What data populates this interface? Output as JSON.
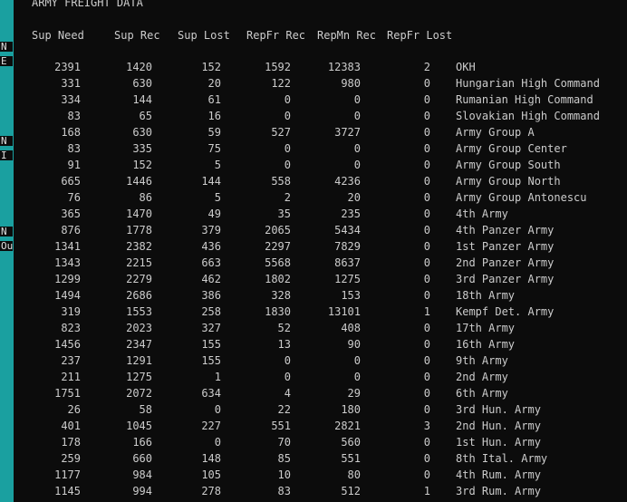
{
  "strip": {
    "fragments": [
      "N",
      "E",
      "N",
      "I",
      "N",
      "Ou"
    ]
  },
  "terminal": {
    "title": "ARMY FREIGHT DATA",
    "columns": {
      "sup_need": "Sup Need",
      "sup_rec": "Sup Rec",
      "sup_lost": "Sup Lost",
      "repfr_rec": "RepFr Rec",
      "repmn_rec": "RepMn Rec",
      "repfr_lost": "RepFr Lost"
    },
    "rows": [
      [
        "2391",
        "1420",
        "152",
        "1592",
        "12383",
        "2",
        "OKH"
      ],
      [
        "331",
        "630",
        "20",
        "122",
        "980",
        "0",
        "Hungarian High Command"
      ],
      [
        "334",
        "144",
        "61",
        "0",
        "0",
        "0",
        "Rumanian High Command"
      ],
      [
        "83",
        "65",
        "16",
        "0",
        "0",
        "0",
        "Slovakian High Command"
      ],
      [
        "168",
        "630",
        "59",
        "527",
        "3727",
        "0",
        "Army Group A"
      ],
      [
        "83",
        "335",
        "75",
        "0",
        "0",
        "0",
        "Army Group Center"
      ],
      [
        "91",
        "152",
        "5",
        "0",
        "0",
        "0",
        "Army Group South"
      ],
      [
        "665",
        "1446",
        "144",
        "558",
        "4236",
        "0",
        "Army Group North"
      ],
      [
        "76",
        "86",
        "5",
        "2",
        "20",
        "0",
        "Army Group Antonescu"
      ],
      [
        "365",
        "1470",
        "49",
        "35",
        "235",
        "0",
        "4th Army"
      ],
      [
        "876",
        "1778",
        "379",
        "2065",
        "5434",
        "0",
        "4th Panzer Army"
      ],
      [
        "1341",
        "2382",
        "436",
        "2297",
        "7829",
        "0",
        "1st Panzer Army"
      ],
      [
        "1343",
        "2215",
        "663",
        "5568",
        "8637",
        "0",
        "2nd Panzer Army"
      ],
      [
        "1299",
        "2279",
        "462",
        "1802",
        "1275",
        "0",
        "3rd Panzer Army"
      ],
      [
        "1494",
        "2686",
        "386",
        "328",
        "153",
        "0",
        "18th Army"
      ],
      [
        "319",
        "1553",
        "258",
        "1830",
        "13101",
        "1",
        "Kempf Det. Army"
      ],
      [
        "823",
        "2023",
        "327",
        "52",
        "408",
        "0",
        "17th Army"
      ],
      [
        "1456",
        "2347",
        "155",
        "13",
        "90",
        "0",
        "16th Army"
      ],
      [
        "237",
        "1291",
        "155",
        "0",
        "0",
        "0",
        "9th Army"
      ],
      [
        "211",
        "1275",
        "1",
        "0",
        "0",
        "0",
        "2nd Army"
      ],
      [
        "1751",
        "2072",
        "634",
        "4",
        "29",
        "0",
        "6th Army"
      ],
      [
        "26",
        "58",
        "0",
        "22",
        "180",
        "0",
        "3rd Hun. Army"
      ],
      [
        "401",
        "1045",
        "227",
        "551",
        "2821",
        "3",
        "2nd Hun. Army"
      ],
      [
        "178",
        "166",
        "0",
        "70",
        "560",
        "0",
        "1st Hun. Army"
      ],
      [
        "259",
        "660",
        "148",
        "85",
        "551",
        "0",
        "8th Ital. Army"
      ],
      [
        "1177",
        "984",
        "105",
        "10",
        "80",
        "0",
        "4th Rum. Army"
      ],
      [
        "1145",
        "994",
        "278",
        "83",
        "512",
        "1",
        "3rd Rum. Army"
      ]
    ]
  }
}
